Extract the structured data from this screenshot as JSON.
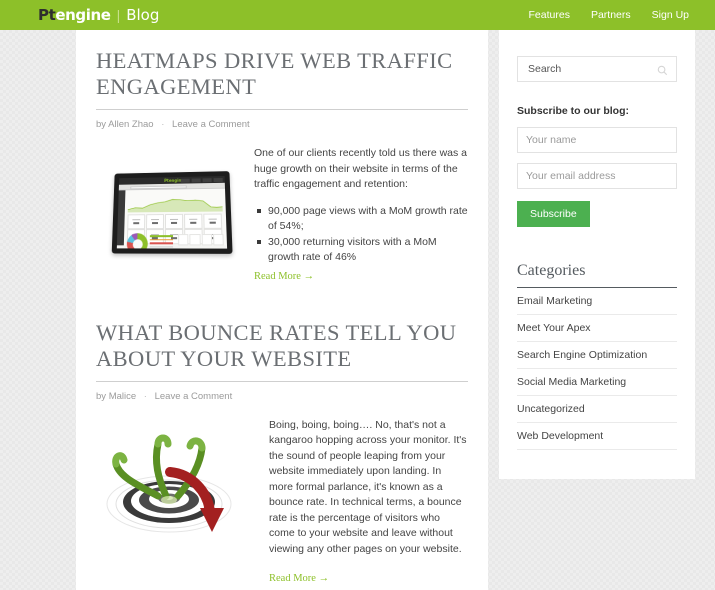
{
  "header": {
    "brand_pt": "Pt",
    "brand_engine": "engine",
    "brand_divider": "|",
    "brand_blog": "Blog",
    "nav": [
      {
        "label": "Features"
      },
      {
        "label": "Partners"
      },
      {
        "label": "Sign Up"
      }
    ],
    "background_color": "#8dc029"
  },
  "articles": [
    {
      "title": "HEATMAPS DRIVE WEB TRAFFIC ENGAGEMENT",
      "author_prefix": "by",
      "author": "Allen Zhao",
      "separator": "·",
      "comment_link": "Leave a Comment",
      "thumbnail": "tablet-analytics-dashboard-image",
      "paragraph": "One of our clients recently told us there was a huge growth on their website in terms of the traffic engagement and retention:",
      "bullets": [
        "90,000 page views with a MoM growth rate of 54%;",
        "30,000 returning visitors with a MoM growth rate of 46%"
      ],
      "read_more": "Read More →"
    },
    {
      "title": "WHAT BOUNCE RATES TELL YOU ABOUT YOUR WEBSITE",
      "author_prefix": "by",
      "author": "Malice",
      "separator": "·",
      "comment_link": "Leave a Comment",
      "thumbnail": "bouncing-arrows-target-image",
      "paragraph": "Boing, boing, boing…. No, that's not a kangaroo hopping across your monitor. It's the sound of people leaping from your website immediately upon landing. In more formal parlance, it's known as a bounce rate. In technical terms, a bounce rate is the percentage of visitors who come to your website and leave without viewing any other pages on your website.",
      "bullets": [],
      "read_more": "Read More →"
    }
  ],
  "sidebar": {
    "search": {
      "placeholder": "Search",
      "value": "",
      "icon": "search-icon"
    },
    "subscribe": {
      "heading": "Subscribe to our blog:",
      "name_placeholder": "Your name",
      "name_value": "",
      "email_placeholder": "Your email address",
      "email_value": "",
      "button_label": "Subscribe",
      "button_color": "#4cb050"
    },
    "categories": {
      "heading": "Categories",
      "items": [
        {
          "label": "Email Marketing"
        },
        {
          "label": "Meet Your Apex"
        },
        {
          "label": "Search Engine Optimization"
        },
        {
          "label": "Social Media Marketing"
        },
        {
          "label": "Uncategorized"
        },
        {
          "label": "Web Development"
        }
      ]
    }
  }
}
